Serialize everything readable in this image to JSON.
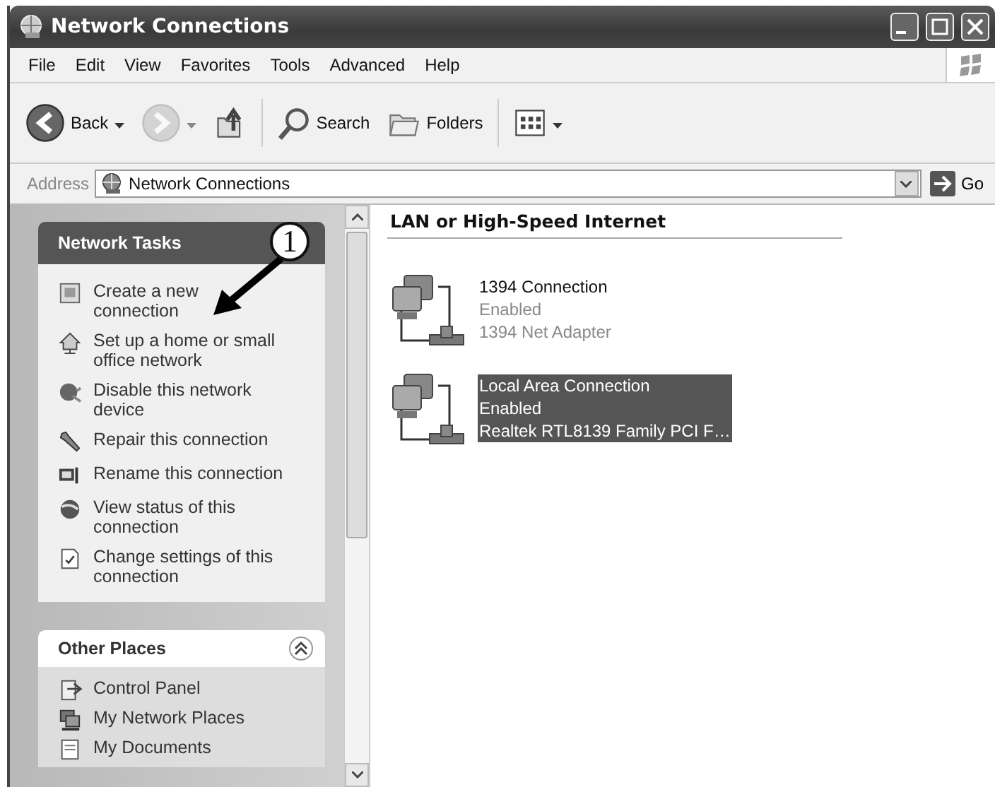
{
  "window": {
    "title": "Network Connections"
  },
  "menu": [
    {
      "label": "File"
    },
    {
      "label": "Edit"
    },
    {
      "label": "View"
    },
    {
      "label": "Favorites"
    },
    {
      "label": "Tools"
    },
    {
      "label": "Advanced"
    },
    {
      "label": "Help"
    }
  ],
  "toolbar": [
    {
      "kind": "back",
      "label": "Back",
      "disabled": false
    },
    {
      "kind": "forward",
      "disabled": true
    },
    {
      "kind": "up",
      "disabled": false
    },
    {
      "kind": "search",
      "label": "Search",
      "disabled": false
    },
    {
      "kind": "folders",
      "label": "Folders",
      "disabled": false
    },
    {
      "kind": "views",
      "disabled": false
    }
  ],
  "address": {
    "label": "Address",
    "value": "Network Connections",
    "go": "Go"
  },
  "sidebar": {
    "panels": [
      {
        "title": "Network Tasks",
        "kind": "primary",
        "items": [
          {
            "kind": "new",
            "label": "Create a new connection"
          },
          {
            "kind": "home",
            "label": "Set up a home or small office network"
          },
          {
            "kind": "disable",
            "label": "Disable this network device"
          },
          {
            "kind": "repair",
            "label": "Repair this connection"
          },
          {
            "kind": "rename",
            "label": "Rename this connection"
          },
          {
            "kind": "status",
            "label": "View status of this connection"
          },
          {
            "kind": "settings",
            "label": "Change settings of this connection"
          }
        ]
      },
      {
        "title": "Other Places",
        "kind": "secondary",
        "items": [
          {
            "kind": "control",
            "label": "Control Panel"
          },
          {
            "kind": "places",
            "label": "My Network Places"
          },
          {
            "kind": "documents",
            "label": "My Documents"
          }
        ]
      }
    ]
  },
  "annotation": {
    "marker": "1"
  },
  "content": {
    "group": "LAN or High-Speed Internet",
    "connections": [
      {
        "name": "1394 Connection",
        "status": "Enabled",
        "adapter": "1394 Net Adapter",
        "selected": false
      },
      {
        "name": "Local Area Connection",
        "status": "Enabled",
        "adapter": "Realtek RTL8139 Family PCI F…",
        "selected": true
      }
    ]
  }
}
